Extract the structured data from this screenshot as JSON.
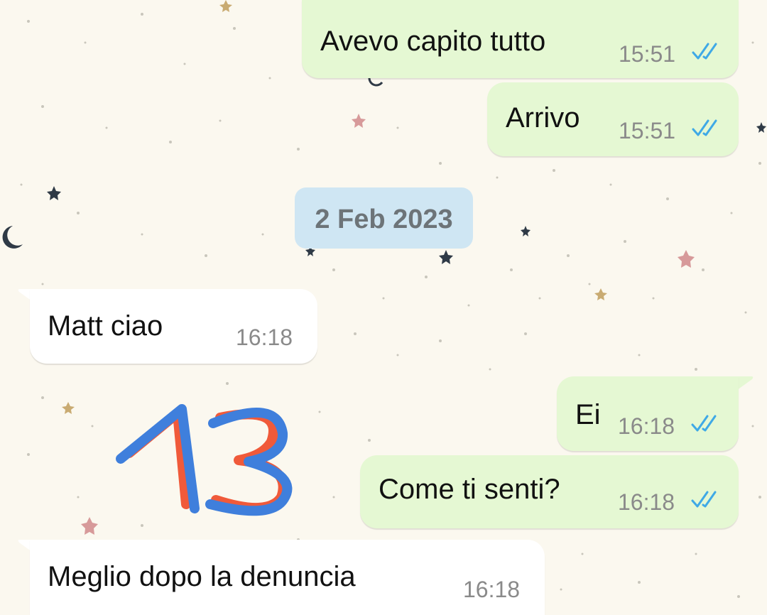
{
  "chat": {
    "messages": [
      {
        "direction": "outgoing",
        "text": "Avevo capito tutto",
        "time": "15:51",
        "status": "read"
      },
      {
        "direction": "outgoing",
        "text": "Arrivo",
        "time": "15:51",
        "status": "read"
      },
      {
        "direction": "incoming",
        "text": "Matt ciao",
        "time": "16:18"
      },
      {
        "direction": "outgoing",
        "text": "Ei",
        "time": "16:18",
        "status": "read"
      },
      {
        "direction": "outgoing",
        "text": "Come ti senti?",
        "time": "16:18",
        "status": "read"
      },
      {
        "direction": "incoming",
        "text": "Meglio dopo la denuncia",
        "time": "16:18"
      }
    ],
    "date_separator": "2 Feb 2023"
  },
  "icons": {
    "read_receipt": "double-check-icon"
  },
  "colors": {
    "outgoing_bubble": "#e5f8d3",
    "incoming_bubble": "#ffffff",
    "date_chip": "#cfe6f3",
    "read_ticks": "#3fa9e6",
    "wallpaper": "#fbf8ef",
    "scribble_red": "#f05a3a",
    "scribble_blue": "#3f7fdc"
  }
}
